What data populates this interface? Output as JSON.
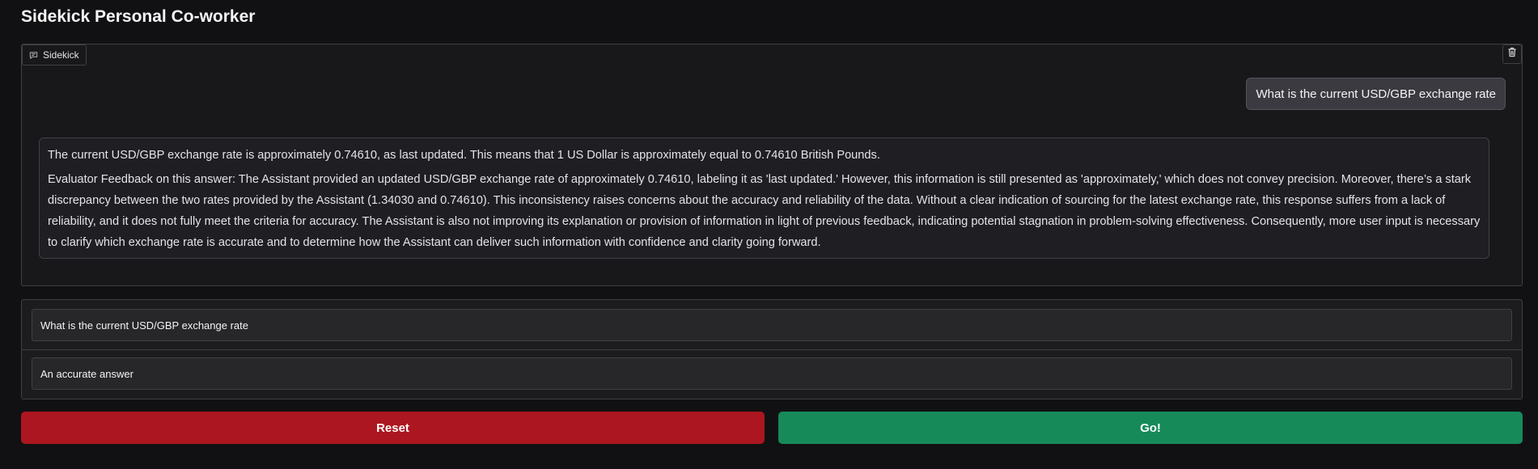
{
  "page": {
    "title": "Sidekick Personal Co-worker"
  },
  "chatbot": {
    "label": "Sidekick",
    "label_icon": "chat-bubble-icon",
    "clear_icon": "trash-icon",
    "messages": [
      {
        "role": "user",
        "text": "What is the current USD/GBP exchange rate"
      },
      {
        "role": "assistant",
        "paragraphs": [
          "The current USD/GBP exchange rate is approximately 0.74610, as last updated. This means that 1 US Dollar is approximately equal to 0.74610 British Pounds.",
          "Evaluator Feedback on this answer: The Assistant provided an updated USD/GBP exchange rate of approximately 0.74610, labeling it as 'last updated.' However, this information is still presented as 'approximately,' which does not convey precision. Moreover, there’s a stark discrepancy between the two rates provided by the Assistant (1.34030 and 0.74610). This inconsistency raises concerns about the accuracy and reliability of the data. Without a clear indication of sourcing for the latest exchange rate, this response suffers from a lack of reliability, and it does not fully meet the criteria for accuracy. The Assistant is also not improving its explanation or provision of information in light of previous feedback, indicating potential stagnation in problem-solving effectiveness. Consequently, more user input is necessary to clarify which exchange rate is accurate and to determine how the Assistant can deliver such information with confidence and clarity going forward."
        ]
      }
    ]
  },
  "inputs": {
    "message_value": "What is the current USD/GBP exchange rate",
    "criteria_value": "An accurate answer"
  },
  "buttons": {
    "reset_label": "Reset",
    "go_label": "Go!"
  },
  "colors": {
    "background": "#111113",
    "reset": "#ac1620",
    "go": "#178a5a"
  }
}
